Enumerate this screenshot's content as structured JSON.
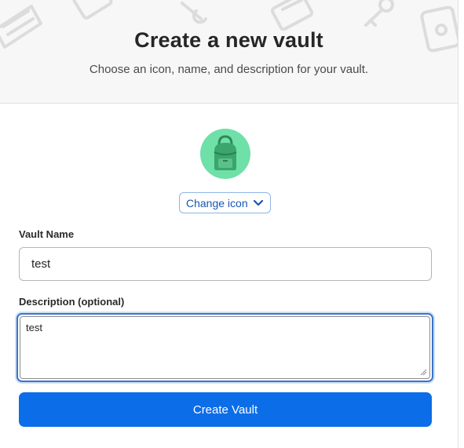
{
  "dialog": {
    "title": "Create a new vault",
    "subtitle": "Choose an icon, name, and description for your vault.",
    "vault_icon": "backpack-icon",
    "change_icon_label": "Change icon",
    "change_icon_chevron": "chevron-down-icon"
  },
  "form": {
    "vault_name_label": "Vault Name",
    "vault_name_value": "test",
    "description_label": "Description (optional)",
    "description_value": "test",
    "submit_label": "Create Vault"
  },
  "colors": {
    "accent": "#0b6de8",
    "icon_background": "#6ee0a8",
    "focus_border": "#3b74c9"
  }
}
